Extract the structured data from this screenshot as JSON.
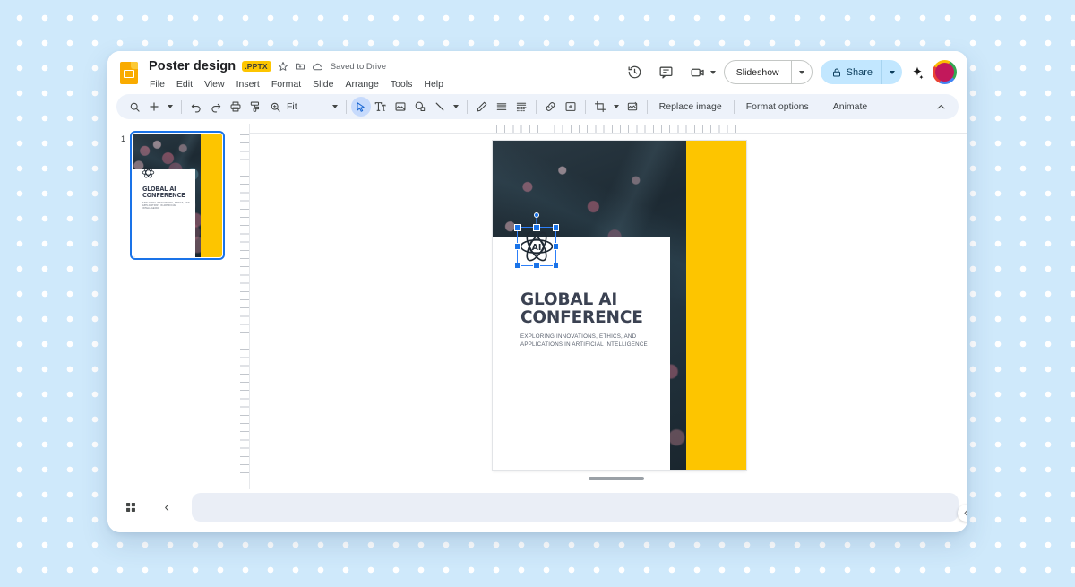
{
  "app": {
    "logo_icon": "google-slides-icon",
    "doc_title": "Poster design",
    "file_badge": ".PPTX",
    "star_icon": "star-icon",
    "move_icon": "move-to-folder-icon",
    "cloud_icon": "cloud-saved-icon",
    "save_status": "Saved to Drive"
  },
  "menubar": {
    "items": [
      {
        "label": "File"
      },
      {
        "label": "Edit"
      },
      {
        "label": "View"
      },
      {
        "label": "Insert"
      },
      {
        "label": "Format"
      },
      {
        "label": "Slide"
      },
      {
        "label": "Arrange"
      },
      {
        "label": "Tools"
      },
      {
        "label": "Help"
      }
    ]
  },
  "header_right": {
    "history_icon": "version-history-icon",
    "comment_icon": "comment-icon",
    "meet_icon": "video-camera-icon",
    "meet_caret_icon": "chevron-down-icon",
    "slideshow_label": "Slideshow",
    "slideshow_caret_icon": "chevron-down-icon",
    "share_lock_icon": "lock-icon",
    "share_label": "Share",
    "share_caret_icon": "chevron-down-icon",
    "gemini_icon": "sparkle-icon",
    "avatar": "user-avatar",
    "avatar_color": "#c2185b"
  },
  "toolbar": {
    "search_icon": "search-icon",
    "add_icon": "plus-icon",
    "add_caret_icon": "chevron-down-icon",
    "undo_icon": "undo-icon",
    "redo_icon": "redo-icon",
    "print_icon": "print-icon",
    "paint_format_icon": "paint-format-icon",
    "zoom_icon": "zoom-icon",
    "zoom_label": "Fit",
    "zoom_caret_icon": "chevron-down-icon",
    "select_icon": "cursor-arrow-icon",
    "textbox_icon": "text-box-icon",
    "image_icon": "insert-image-icon",
    "shape_icon": "shape-icon",
    "line_icon": "line-icon",
    "line_caret_icon": "chevron-down-icon",
    "highlight_icon": "pen-icon",
    "align_icon": "align-icon",
    "transition_icon": "transition-icon",
    "link_icon": "insert-link-icon",
    "comment_add_icon": "add-comment-icon",
    "crop_icon": "crop-icon",
    "crop_caret_icon": "chevron-down-icon",
    "mask_icon": "image-mask-icon",
    "replace_image_label": "Replace image",
    "format_options_label": "Format options",
    "animate_label": "Animate",
    "collapse_icon": "chevron-up-icon",
    "accent_color": "#c6dafc"
  },
  "filmstrip": {
    "slides": [
      {
        "number": "1",
        "selected": true
      }
    ],
    "selection_color": "#1a73e8"
  },
  "slide": {
    "poster": {
      "title": "GLOBAL AI\nCONFERENCE",
      "subtitle": "EXPLORING INNOVATIONS, ETHICS, AND\nAPPLICATIONS IN ARTIFICIAL INTELLIGENCE",
      "logo_icon": "ai-atom-icon",
      "logo_text": "AI",
      "accent_color": "#fdc500",
      "title_color": "#3b4252",
      "photo_description": "circuit-board-photo"
    },
    "selection": {
      "selected_object": "ai-atom-logo-image",
      "handle_color": "#1a73e8"
    }
  },
  "bottom_bar": {
    "grid_icon": "grid-view-icon",
    "collapse_filmstrip_icon": "chevron-left-icon",
    "notes_placeholder": "",
    "panel_collapse_icon": "chevron-left-icon"
  }
}
